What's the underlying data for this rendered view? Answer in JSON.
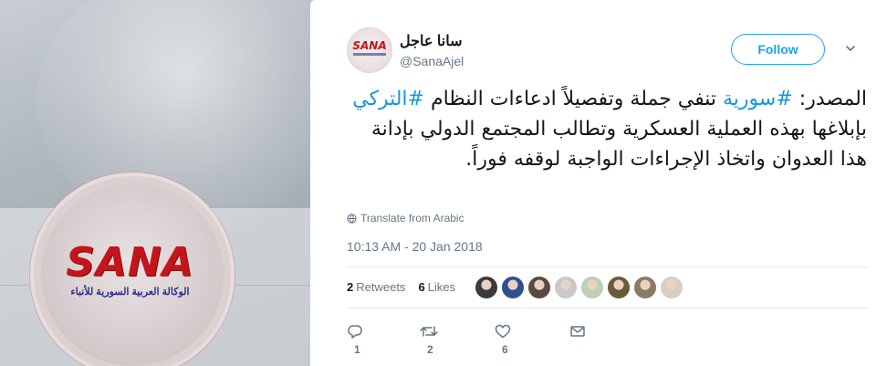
{
  "background": {
    "logo_word": "SANA",
    "logo_subtitle": "الوكالة العربية السورية للأنباء"
  },
  "tweet": {
    "display_name": "سانا عاجل",
    "screen_name": "@SanaAjel",
    "avatar_logo_word": "SANA",
    "follow_label": "Follow",
    "text_parts": {
      "p1": "المصدر: ",
      "hashtag1": "#سورية",
      "p2": " تنفي جملة وتفصيلاً ادعاءات النظام ",
      "hashtag2": "#التركي",
      "p3": " بإبلاغها بهذه العملية العسكرية وتطالب المجتمع الدولي بإدانة هذا العدوان واتخاذ الإجراءات الواجبة لوقفه فوراً."
    },
    "translate_label": "Translate from Arabic",
    "timestamp": "10:13 AM - 20 Jan 2018",
    "retweets_count": "2",
    "retweets_label": "Retweets",
    "likes_count": "6",
    "likes_label": "Likes",
    "liker_face_colors": [
      "#3a3a3a",
      "#2f4f8f",
      "#5a4a42",
      "#c9c9c9",
      "#bcd0b8",
      "#6b5a3a",
      "#8a7a6a",
      "#d6d0c4"
    ],
    "actions": {
      "reply_count": "1",
      "retweet_count": "2",
      "like_count": "6"
    },
    "colors": {
      "accent": "#1da1f2",
      "hashtag": "#1b95e0",
      "muted": "#657786"
    }
  }
}
